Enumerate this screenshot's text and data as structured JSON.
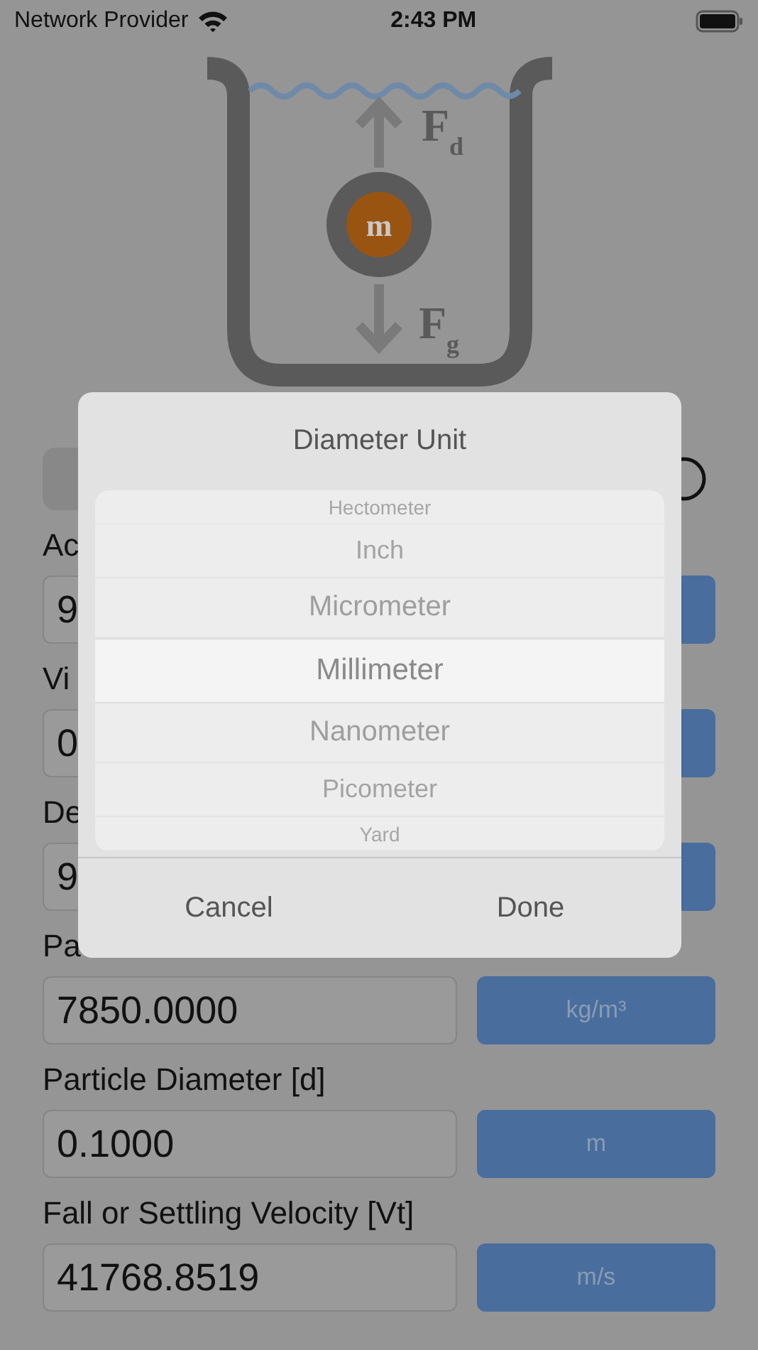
{
  "status_bar": {
    "carrier": "Network Provider",
    "time": "2:43 PM"
  },
  "diagram": {
    "mass_label": "m",
    "drag_force": {
      "symbol": "F",
      "subscript": "d"
    },
    "gravity_force": {
      "symbol": "F",
      "subscript": "g"
    }
  },
  "fields": [
    {
      "label": "Ac",
      "value": "9"
    },
    {
      "label": "Vi",
      "value": "0"
    },
    {
      "label": "De",
      "value": "9"
    },
    {
      "label": "Pa",
      "value": "7850.0000",
      "unit": "kg/m³"
    },
    {
      "label": "Particle Diameter [d]",
      "value": "0.1000",
      "unit": "m"
    },
    {
      "label": "Fall or Settling Velocity [Vt]",
      "value": "41768.8519",
      "unit": "m/s"
    }
  ],
  "dialog": {
    "title": "Diameter Unit",
    "options": [
      {
        "label": "Hectometer",
        "selected": false
      },
      {
        "label": "Inch",
        "selected": false
      },
      {
        "label": "Micrometer",
        "selected": false
      },
      {
        "label": "Millimeter",
        "selected": true
      },
      {
        "label": "Nanometer",
        "selected": false
      },
      {
        "label": "Picometer",
        "selected": false
      },
      {
        "label": "Yard",
        "selected": false
      }
    ],
    "buttons": [
      "Cancel",
      "Done"
    ]
  }
}
